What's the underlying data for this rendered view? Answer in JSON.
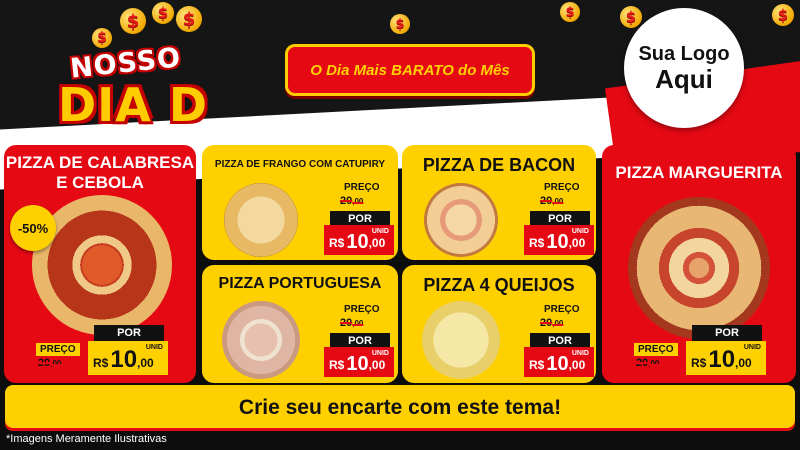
{
  "header": {
    "logo_line1": "NOSSO",
    "logo_line2": "DIA D",
    "banner_text": "O Dia Mais BARATO do Mês",
    "logo_placeholder_line1": "Sua Logo",
    "logo_placeholder_line2": "Aqui",
    "dollar_glyph": "$"
  },
  "colors": {
    "red": "#e50914",
    "yellow": "#ffd000",
    "dark": "#151515"
  },
  "price_labels": {
    "preco": "PREÇO",
    "por": "POR",
    "unid": "UNID",
    "currency": "R$"
  },
  "products": [
    {
      "name": "PIZZA DE CALABRESA E CEBOLA",
      "name_line1": "PIZZA DE CALABRESA",
      "name_line2": "E CEBOLA",
      "discount": "-50%",
      "old_int": "20",
      "old_dec": ",00",
      "new_int": "10",
      "new_dec": ",00"
    },
    {
      "name": "PIZZA DE FRANGO COM CATUPIRY",
      "old_int": "20",
      "old_dec": ",00",
      "new_int": "10",
      "new_dec": ",00"
    },
    {
      "name": "PIZZA DE BACON",
      "old_int": "20",
      "old_dec": ",00",
      "new_int": "10",
      "new_dec": ",00"
    },
    {
      "name": "PIZZA PORTUGUESA",
      "old_int": "20",
      "old_dec": ",00",
      "new_int": "10",
      "new_dec": ",00"
    },
    {
      "name": "PIZZA 4 QUEIJOS",
      "old_int": "20",
      "old_dec": ",00",
      "new_int": "10",
      "new_dec": ",00"
    },
    {
      "name": "PIZZA MARGUERITA",
      "old_int": "20",
      "old_dec": ",00",
      "new_int": "10",
      "new_dec": ",00"
    }
  ],
  "cta_text": "Crie seu encarte com este tema!",
  "footer_note": "*Imagens Meramente Ilustrativas"
}
